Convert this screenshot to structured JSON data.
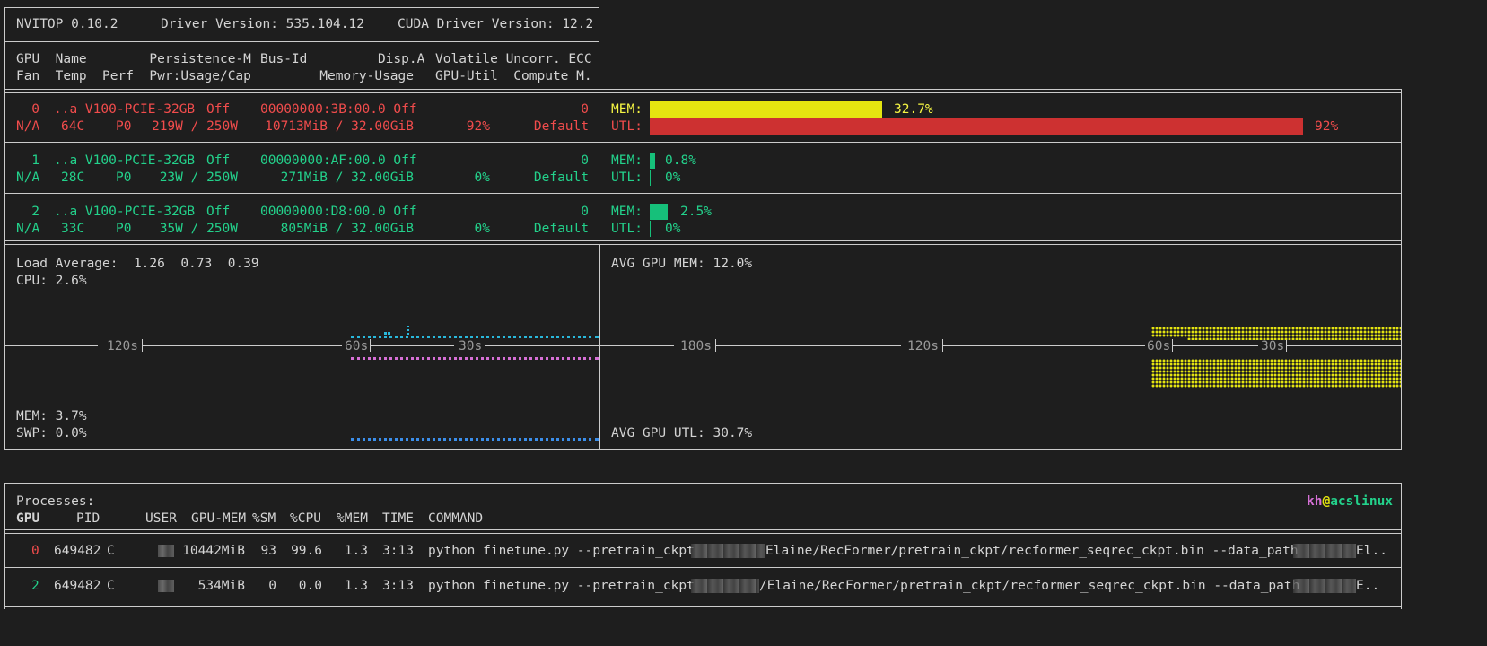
{
  "header": {
    "app": "NVITOP 0.10.2",
    "driver": "Driver Version: 535.104.12",
    "cuda": "CUDA Driver Version: 12.2"
  },
  "columns": {
    "c1a": "GPU  Name        Persistence-M",
    "c1b": "Fan  Temp  Perf  Pwr:Usage/Cap",
    "c2a": "Bus-Id         Disp.A",
    "c2b": "Memory-Usage",
    "c3a": "Volatile Uncorr. ECC",
    "c3b": "GPU-Util  Compute M."
  },
  "gpus": [
    {
      "id": "0",
      "name": "..a V100-PCIE-32GB",
      "persistence": "Off",
      "fan": "N/A",
      "temp": "64C",
      "perf": "P0",
      "power": "219W / 250W",
      "bus": "00000000:3B:00.0 Off",
      "memory": "10713MiB / 32.00GiB",
      "ecc": "0",
      "util": "92%",
      "compute": "Default",
      "mem_label": "MEM:",
      "mem_pct": "32.7%",
      "mem_frac": 0.327,
      "utl_label": "UTL:",
      "utl_pct": "92%",
      "utl_frac": 0.92,
      "color": "#f14c4c"
    },
    {
      "id": "1",
      "name": "..a V100-PCIE-32GB",
      "persistence": "Off",
      "fan": "N/A",
      "temp": "28C",
      "perf": "P0",
      "power": "23W / 250W",
      "bus": "00000000:AF:00.0 Off",
      "memory": "271MiB / 32.00GiB",
      "ecc": "0",
      "util": "0%",
      "compute": "Default",
      "mem_label": "MEM:",
      "mem_pct": "0.8%",
      "mem_frac": 0.008,
      "utl_label": "UTL:",
      "utl_pct": "0%",
      "utl_frac": 0,
      "color": "#23d18b"
    },
    {
      "id": "2",
      "name": "..a V100-PCIE-32GB",
      "persistence": "Off",
      "fan": "N/A",
      "temp": "33C",
      "perf": "P0",
      "power": "35W / 250W",
      "bus": "00000000:D8:00.0 Off",
      "memory": "805MiB / 32.00GiB",
      "ecc": "0",
      "util": "0%",
      "compute": "Default",
      "mem_label": "MEM:",
      "mem_pct": "2.5%",
      "mem_frac": 0.025,
      "utl_label": "UTL:",
      "utl_pct": "0%",
      "utl_frac": 0,
      "color": "#23d18b"
    }
  ],
  "host": {
    "load": "Load Average:  1.26  0.73  0.39",
    "cpu": "CPU: 2.6%",
    "mem": "MEM: 3.7%",
    "swp": "SWP: 0.0%",
    "ticks": [
      "120s",
      "60s",
      "30s"
    ]
  },
  "avg": {
    "mem": "AVG GPU MEM: 12.0%",
    "utl": "AVG GPU UTL: 30.7%",
    "ticks": [
      "180s",
      "120s",
      "60s",
      "30s"
    ]
  },
  "processes": {
    "title": "Processes:",
    "user_host": {
      "user": "kh",
      "at": "@",
      "host": "acslinux"
    },
    "headers": {
      "gpu": "GPU",
      "pid": "PID",
      "user": "USER",
      "gpumem": "GPU-MEM",
      "sm": "%SM",
      "cpu": "%CPU",
      "mem": "%MEM",
      "time": "TIME",
      "command": "COMMAND"
    },
    "rows": [
      {
        "gpu": "0",
        "pid": "649482",
        "type": "C",
        "gpumem": "10442MiB",
        "sm": "93",
        "cpu": "99.6",
        "mem": "1.3",
        "time": "3:13",
        "cmd_a": "python finetune.py --pretrain_ckpt",
        "cmd_b": "Elaine/RecFormer/pretrain_ckpt/recformer_seqrec_ckpt.bin --data_path",
        "cmd_c": "El..",
        "color": "#f14c4c"
      },
      {
        "gpu": "2",
        "pid": "649482",
        "type": "C",
        "gpumem": "534MiB",
        "sm": "0",
        "cpu": "0.0",
        "mem": "1.3",
        "time": "3:13",
        "cmd_a": "python finetune.py --pretrain_ckpt",
        "cmd_b": "/Elaine/RecFormer/pretrain_ckpt/recformer_seqrec_ckpt.bin --data_path",
        "cmd_c": "E..",
        "color": "#23d18b"
      }
    ]
  }
}
